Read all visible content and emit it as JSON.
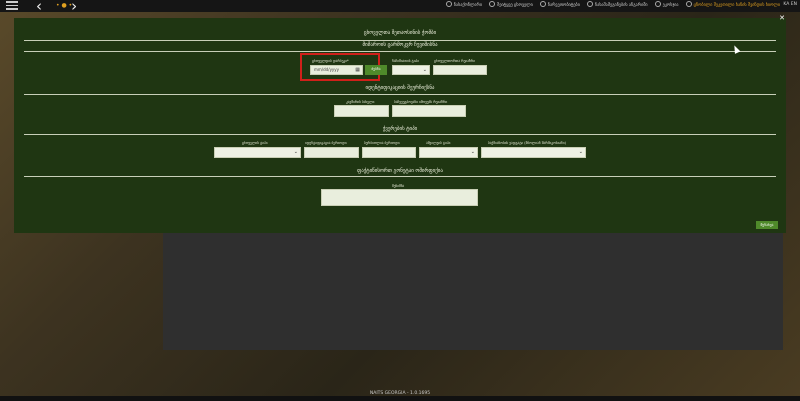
{
  "topbar": {
    "links": [
      {
        "label": "ნასაქონლარი"
      },
      {
        "label": "შეიტყვე ცხოველი"
      },
      {
        "label": "ნარვეთობიტები"
      },
      {
        "label": "ჩასაშამეგინების ანგარიში"
      },
      {
        "label": "ეკოსჯია"
      }
    ],
    "active_link": "ცნობილი შეკეთილი ხანის შვინდის ხიოლი",
    "lang": "KA EN"
  },
  "modal": {
    "title": "ცხოველთა შეთაოსინის ჭომბი",
    "section1": {
      "title": "მიმაროის ცარმოკვრ ჩუვიშისნა",
      "date_label": "ცხოველდის დარბეკი*",
      "date_placeholder": "mm/dd/yyyy",
      "date_button": "ძებნა",
      "select_label": "ჩაჩიშიათის ტიპი",
      "input_label": "ცხოველთორთა რეიაზრი"
    },
    "section2": {
      "title": "იდენტიფიკაციის შეურჩიქსნა",
      "field1_label": "კავშირის სახელი",
      "field2_label": "საჩვეუგბოვანი იმოვებს რეიაზრი"
    },
    "section3": {
      "title": "ქვერების ტიპი",
      "labels": [
        "ცხოველის ტიპი",
        "იდენტიფიკაცია ბერიოდი",
        "სერბიოლია ბერიოდი",
        "აშვილეის ტიპი",
        "საქმიანობის ვადგატი (მბოლიან შარმიკოსიანი)"
      ]
    },
    "section4": {
      "title": "ფაქტიწისორთ გონეტაი ოშირფიქია",
      "comment_label": "შენიშნა"
    },
    "save_button": "შენახვა"
  },
  "footer": {
    "text": "NAITS GEORGIA - 1.0.1695"
  }
}
